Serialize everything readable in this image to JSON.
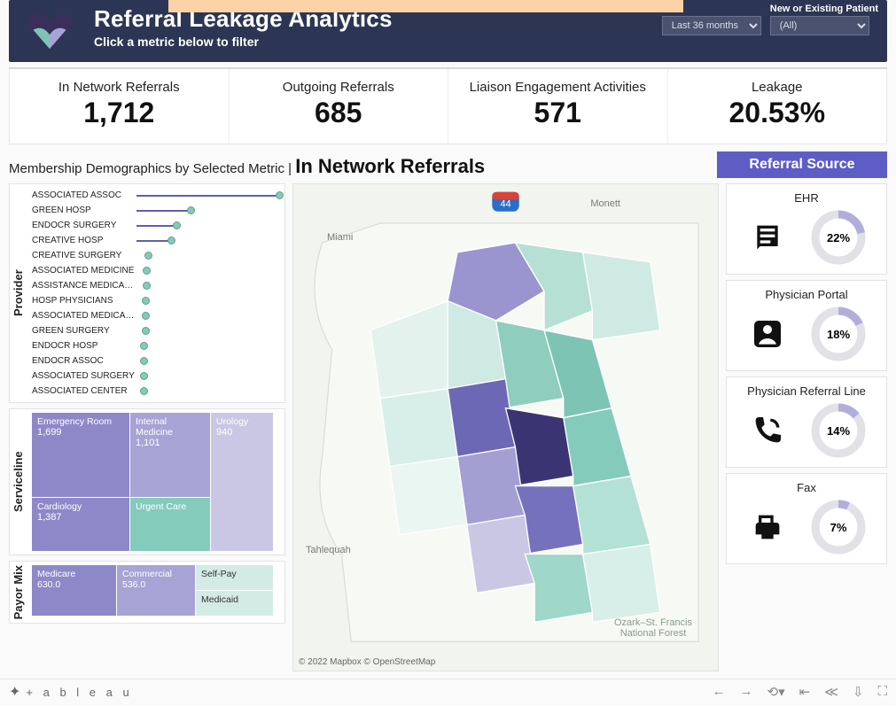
{
  "header": {
    "title": "Referral Leakage Analytics",
    "subtitle": "Click a metric below to filter",
    "period_selector": {
      "value": "Last 36 months"
    },
    "patient_selector": {
      "label": "New or Existing Patient",
      "value": "(All)"
    }
  },
  "metrics": [
    {
      "label": "In Network Referrals",
      "value": "1,712"
    },
    {
      "label": "Outgoing Referrals",
      "value": "685"
    },
    {
      "label": "Liaison Engagement Activities",
      "value": "571"
    },
    {
      "label": "Leakage",
      "value": "20.53%"
    }
  ],
  "section": {
    "prefix": "Membership Demographics by Selected Metric | ",
    "selected": "In Network Referrals"
  },
  "providers": [
    {
      "name": "ASSOCIATED ASSOC",
      "v": 100,
      "line": true
    },
    {
      "name": "GREEN HOSP",
      "v": 38,
      "line": true
    },
    {
      "name": "ENDOCR SURGERY",
      "v": 28,
      "line": true
    },
    {
      "name": "CREATIVE  HOSP",
      "v": 24,
      "line": true
    },
    {
      "name": "CREATIVE  SURGERY",
      "v": 8
    },
    {
      "name": "ASSOCIATED MEDICINE",
      "v": 7
    },
    {
      "name": "ASSISTANCE MEDICAL C..",
      "v": 7
    },
    {
      "name": "HOSP PHYSICIANS",
      "v": 6
    },
    {
      "name": "ASSOCIATED MEDICAL G..",
      "v": 6
    },
    {
      "name": "GREEN SURGERY",
      "v": 6
    },
    {
      "name": "ENDOCR HOSP",
      "v": 5
    },
    {
      "name": "ENDOCR ASSOC",
      "v": 5
    },
    {
      "name": "ASSOCIATED SURGERY",
      "v": 5
    },
    {
      "name": "ASSOCIATED CENTER",
      "v": 5
    }
  ],
  "serviceline": {
    "cells": {
      "er": {
        "label": "Emergency Room",
        "value": "1,699"
      },
      "cardio": {
        "label": "Cardiology",
        "value": "1,387"
      },
      "im": {
        "label": "Internal Medicine",
        "value": "1,101"
      },
      "uc": {
        "label": "Urgent Care",
        "value": ""
      },
      "uro": {
        "label": "Urology",
        "value": "940"
      }
    }
  },
  "payor": {
    "medicare": {
      "label": "Medicare",
      "value": "630.0"
    },
    "commercial": {
      "label": "Commercial",
      "value": "536.0"
    },
    "selfpay": {
      "label": "Self-Pay",
      "value": ""
    },
    "medicaid": {
      "label": "Medicaid",
      "value": ""
    }
  },
  "map": {
    "labels": {
      "miami": "Miami",
      "monett": "Monett",
      "tahlequah": "Tahlequah",
      "forest": "Ozark–St. Francis National Forest"
    },
    "copyright": "© 2022 Mapbox  © OpenStreetMap"
  },
  "referral_source": {
    "title": "Referral Source",
    "items": [
      {
        "name": "EHR",
        "pct": 22
      },
      {
        "name": "Physician Portal",
        "pct": 18
      },
      {
        "name": "Physician Referral Line",
        "pct": 14
      },
      {
        "name": "Fax",
        "pct": 7
      }
    ]
  },
  "vlabels": {
    "provider": "Provider",
    "serviceline": "Serviceline",
    "payor": "Payor Mix"
  },
  "footer_brand": "+ a b l e a u",
  "chart_data": {
    "metrics": {
      "in_network": 1712,
      "outgoing": 685,
      "liaison": 571,
      "leakage_pct": 20.53
    },
    "provider_bar": {
      "type": "bar",
      "orientation": "horizontal",
      "title": "Provider — In Network Referrals (relative)",
      "categories": [
        "ASSOCIATED ASSOC",
        "GREEN HOSP",
        "ENDOCR SURGERY",
        "CREATIVE HOSP",
        "CREATIVE SURGERY",
        "ASSOCIATED MEDICINE",
        "ASSISTANCE MEDICAL C..",
        "HOSP PHYSICIANS",
        "ASSOCIATED MEDICAL G..",
        "GREEN SURGERY",
        "ENDOCR HOSP",
        "ENDOCR ASSOC",
        "ASSOCIATED SURGERY",
        "ASSOCIATED CENTER"
      ],
      "values": [
        100,
        38,
        28,
        24,
        8,
        7,
        7,
        6,
        6,
        6,
        5,
        5,
        5,
        5
      ],
      "note": "values are relative percentages of max; chart has no numeric axis labels"
    },
    "serviceline_treemap": {
      "type": "treemap",
      "title": "Serviceline",
      "items": [
        {
          "name": "Emergency Room",
          "value": 1699
        },
        {
          "name": "Cardiology",
          "value": 1387
        },
        {
          "name": "Internal Medicine",
          "value": 1101
        },
        {
          "name": "Urology",
          "value": 940
        },
        {
          "name": "Urgent Care",
          "value": null
        }
      ]
    },
    "payor_treemap": {
      "type": "treemap",
      "title": "Payor Mix",
      "items": [
        {
          "name": "Medicare",
          "value": 630.0
        },
        {
          "name": "Commercial",
          "value": 536.0
        },
        {
          "name": "Self-Pay",
          "value": null
        },
        {
          "name": "Medicaid",
          "value": null
        }
      ]
    },
    "referral_source_donuts": {
      "type": "pie",
      "series": [
        {
          "name": "EHR",
          "values": [
            22,
            78
          ]
        },
        {
          "name": "Physician Portal",
          "values": [
            18,
            82
          ]
        },
        {
          "name": "Physician Referral Line",
          "values": [
            14,
            86
          ]
        },
        {
          "name": "Fax",
          "values": [
            7,
            93
          ]
        }
      ],
      "labels": [
        "value_pct",
        "remainder"
      ]
    }
  }
}
